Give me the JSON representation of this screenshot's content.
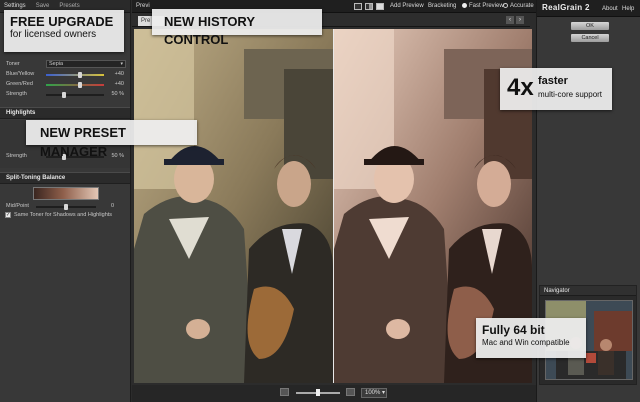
{
  "settings_panel": {
    "header": [
      "Settings",
      "Save",
      "Presets"
    ],
    "preset_row_label": "Pre",
    "toner": {
      "label": "Toner",
      "value": "Sepia",
      "blue_yellow": {
        "label": "Blue/Yellow",
        "value": "+40",
        "fraction": 0.55
      },
      "green_red": {
        "label": "Green/Red",
        "value": "+40",
        "fraction": 0.55
      },
      "strength": {
        "label": "Strength",
        "value": "50",
        "unit": "%",
        "fraction": 0.3
      }
    },
    "highlights": {
      "label": "Highlights",
      "strength": {
        "label": "Strength",
        "value": "50",
        "unit": "%",
        "fraction": 0.3
      }
    },
    "split_toning": {
      "label": "Split-Toning Balance",
      "midpoint_label": "Mid/Point",
      "midpoint_value": "0",
      "midpoint_fraction": 0.5,
      "same_toner_label": "Same Toner for Shadows and Highlights",
      "same_toner_checked": true
    }
  },
  "toolbar": {
    "preview_label": "Previ",
    "add_preview": "Add Preview",
    "bracketing": "Bracketing",
    "fast_preview": "Fast Preview",
    "accurate": "Accurate",
    "mode": "Fast Preview"
  },
  "tabs": {
    "preview_tab": "Pre"
  },
  "zoom": {
    "value": "100%",
    "slider_fraction": 0.5
  },
  "right_panel": {
    "brand": "RealGrain 2",
    "menu": [
      "About",
      "Help"
    ],
    "ok": "OK",
    "cancel": "Cancel"
  },
  "navigator": {
    "label": "Navigator"
  },
  "callouts": {
    "free_upgrade": {
      "title": "FREE UPGRADE",
      "subtitle": "for licensed owners"
    },
    "history": {
      "title": "NEW HISTORY CONTROL"
    },
    "preset": {
      "title": "NEW PRESET MANAGER"
    },
    "faster": {
      "number": "4x",
      "word": "faster",
      "subtitle": "multi-core support"
    },
    "bit64": {
      "title": "Fully 64 bit",
      "subtitle": "Mac and Win compatible"
    }
  },
  "colors": {
    "sepia_light": "#e3c7b6",
    "sepia_dark": "#3a2620",
    "accent": "#ededed"
  }
}
